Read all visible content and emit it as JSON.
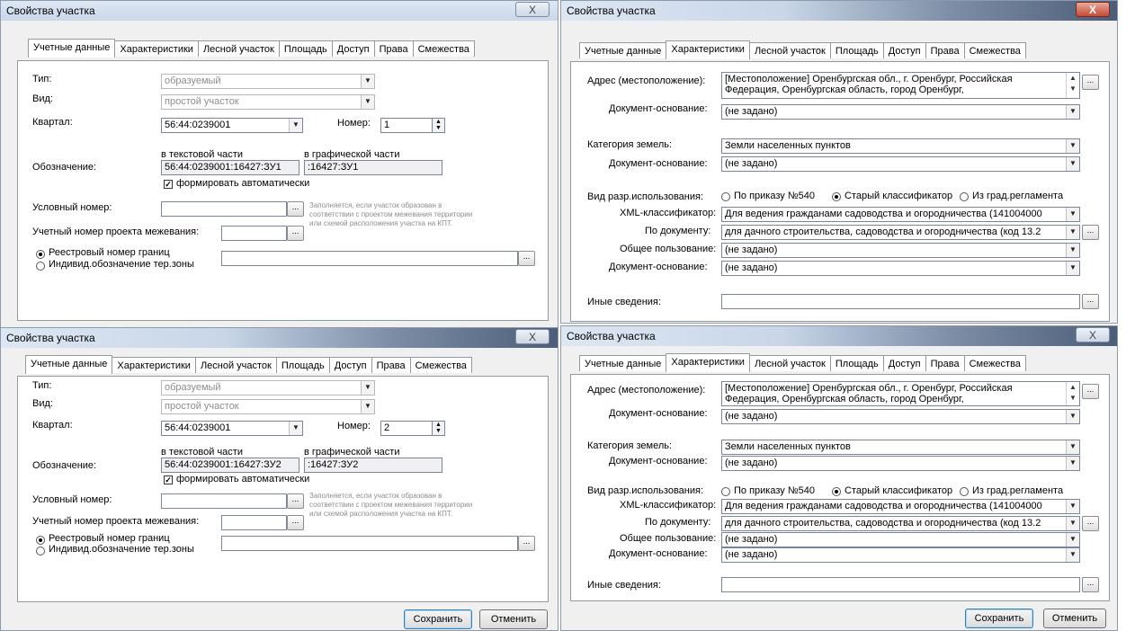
{
  "window_title": "Свойства участка",
  "tabs": [
    "Учетные данные",
    "Характеристики",
    "Лесной участок",
    "Площадь",
    "Доступ",
    "Права",
    "Смежества"
  ],
  "close_glyph": "X",
  "more_glyph": "...",
  "check_glyph": "✓",
  "accounting": {
    "type_label": "Тип:",
    "type_value": "образуемый",
    "kind_label": "Вид:",
    "kind_value": "простой участок",
    "quarter_label": "Квартал:",
    "quarter_value": "56:44:0239001",
    "number_label": "Номер:",
    "text_part_label": "в текстовой части",
    "graphic_part_label": "в графической части",
    "designation_label": "Обозначение:",
    "auto_label": "формировать автоматически",
    "cond_number_label": "Условный номер:",
    "hint_line1": "Заполняется, если участок образован в",
    "hint_line2": "соответствии с проектом межевания территории",
    "hint_line3": "или схемой расположения участка на КПТ.",
    "project_number_label": "Учетный номер проекта межевания:",
    "radio_registry": "Реестровый номер границ",
    "radio_individual": "Индивид.обозначение тер.зоны"
  },
  "dialog_tl": {
    "number_value": "1",
    "designation_text": "56:44:0239001:16427:ЗУ1",
    "designation_graphic": ":16427:ЗУ1"
  },
  "dialog_bl": {
    "number_value": "2",
    "designation_text": "56:44:0239001:16427:ЗУ2",
    "designation_graphic": ":16427:ЗУ2",
    "save_label": "Сохранить",
    "cancel_label": "Отменить"
  },
  "characteristics": {
    "address_label": "Адрес (местоположение):",
    "address_line1": "[Местоположение] Оренбургская обл., г. Оренбург, Российская",
    "address_line2": "Федерация, Оренбургская область, город Оренбург,",
    "doc_basis_label": "Документ-основание:",
    "not_set": "(не задано)",
    "land_category_label": "Категория земель:",
    "land_category_value": "Земли населенных пунктов",
    "permitted_use_label": "Вид разр.использования:",
    "by_order": "По приказу №540",
    "old_classifier": "Старый классификатор",
    "from_urban": "Из град.регламента",
    "xml_classifier_label": "XML-классификатор:",
    "xml_classifier_value": "Для ведения гражданами садоводства и огородничества (141004000",
    "by_document_label": "По документу:",
    "by_document_value": "для дачного строительства, садоводства и огородничества (код 13.2",
    "public_use_label": "Общее пользование:",
    "other_info_label": "Иные сведения:"
  },
  "dialog_br": {
    "save_label": "Сохранить",
    "cancel_label": "Отменить"
  }
}
